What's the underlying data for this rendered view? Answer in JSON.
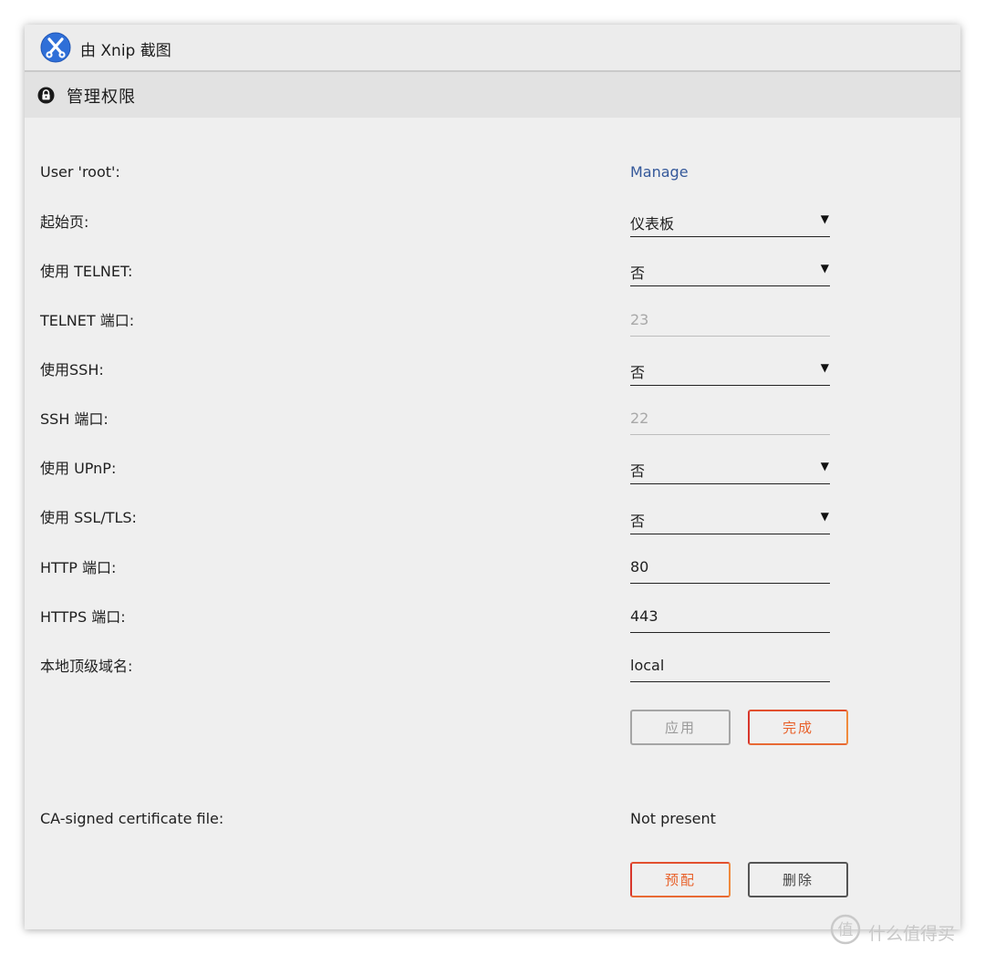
{
  "titlebar": {
    "title": "由 Xnip 截图",
    "logo_icon": "xnip-scissors-icon"
  },
  "section": {
    "title": "管理权限",
    "icon": "lock-icon"
  },
  "rows": {
    "user": {
      "label": "User 'root':",
      "link": "Manage"
    },
    "start_page": {
      "label": "起始页:",
      "value": "仪表板"
    },
    "telnet": {
      "label": "使用 TELNET:",
      "value": "否"
    },
    "telnet_port": {
      "label": "TELNET 端口:",
      "value": "23"
    },
    "ssh": {
      "label": "使用SSH:",
      "value": "否"
    },
    "ssh_port": {
      "label": "SSH 端口:",
      "value": "22"
    },
    "upnp": {
      "label": "使用 UPnP:",
      "value": "否"
    },
    "ssl": {
      "label": "使用 SSL/TLS:",
      "value": "否"
    },
    "http_port": {
      "label": "HTTP 端口:",
      "value": "80"
    },
    "https_port": {
      "label": "HTTPS 端口:",
      "value": "443"
    },
    "tld": {
      "label": "本地顶级域名:",
      "value": "local"
    }
  },
  "buttons": {
    "apply": "应用",
    "done": "完成"
  },
  "certificate": {
    "label": "CA-signed certificate file:",
    "status": "Not present",
    "provision_button": "预配",
    "delete_button": "删除"
  },
  "watermark": {
    "text": "什么值得买"
  },
  "colors": {
    "link": "#34589a",
    "accent_orange": "#e8612a",
    "accent_red": "#d8362b",
    "header_bg": "#e2e2e2",
    "panel_bg": "#efefef"
  }
}
